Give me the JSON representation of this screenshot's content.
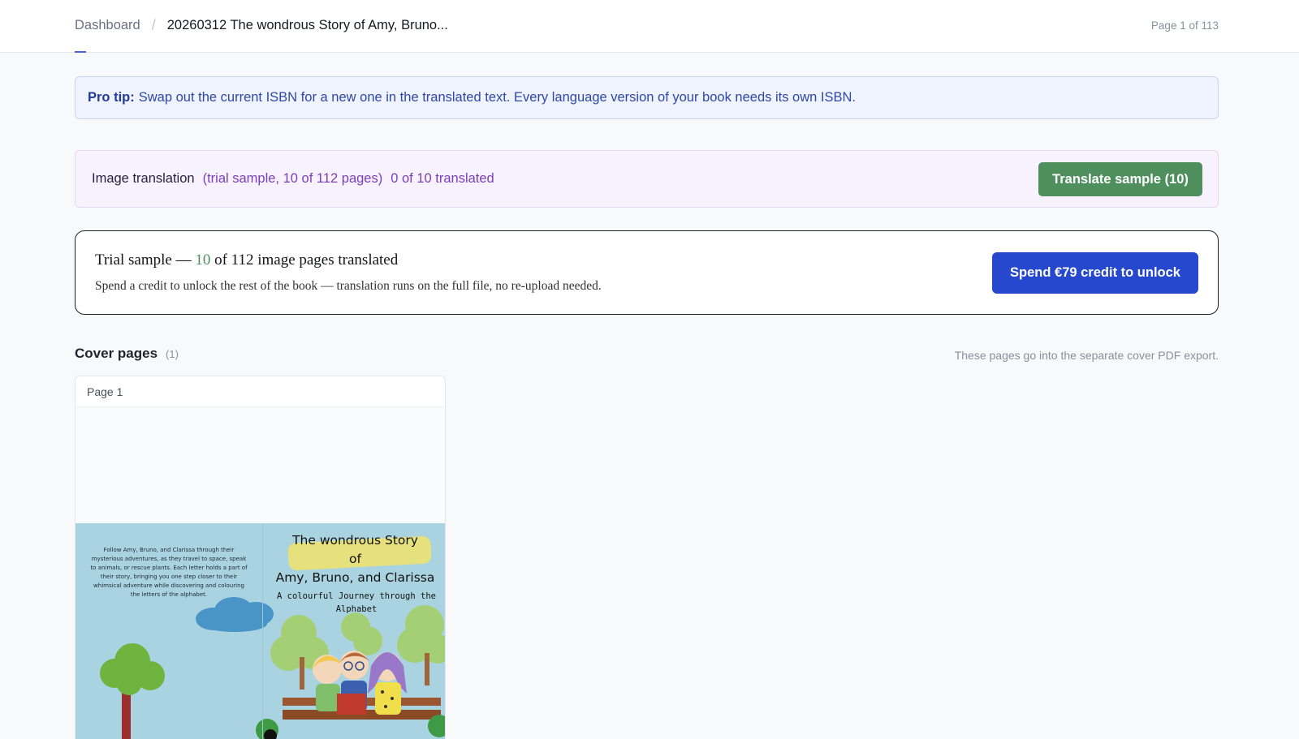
{
  "header": {
    "breadcrumb_root": "Dashboard",
    "breadcrumb_separator": "/",
    "breadcrumb_current": "20260312 The wondrous Story of Amy, Bruno...",
    "page_counter": "Page 1 of 113"
  },
  "protip": {
    "label": "Pro tip:",
    "text": "Swap out the current ISBN for a new one in the translated text. Every language version of your book needs its own ISBN."
  },
  "image_translation": {
    "label": "Image translation",
    "meta": "(trial sample, 10 of 112 pages)",
    "progress": "0 of 10 translated",
    "button_label": "Translate sample (10)"
  },
  "trial": {
    "title_prefix": "Trial sample — ",
    "title_count": "10",
    "title_suffix": " of 112 image pages translated",
    "subtitle": "Spend a credit to unlock the rest of the book — translation runs on the full file, no re-upload needed.",
    "button_label": "Spend €79 credit to unlock"
  },
  "cover": {
    "section_title": "Cover pages",
    "section_count": "(1)",
    "note": "These pages go into the separate cover PDF export.",
    "page_label": "Page 1",
    "blurb": "Follow Amy, Bruno, and Clarissa through their mysterious adventures, as they travel to space, speak to animals, or rescue plants. Each letter holds a part of their story, bringing you one step closer to their whimsical adventure while discovering and colouring the letters of the alphabet.",
    "book_title_line1": "The wondrous Story",
    "book_title_line2": "of",
    "book_title_line3": "Amy, Bruno, and Clarissa",
    "book_subtitle": "A colourful Journey through the Alphabet"
  },
  "colors": {
    "accent_blue": "#2548cf",
    "accent_green": "#4f8f5e",
    "purple_text": "#7a3fb6"
  }
}
